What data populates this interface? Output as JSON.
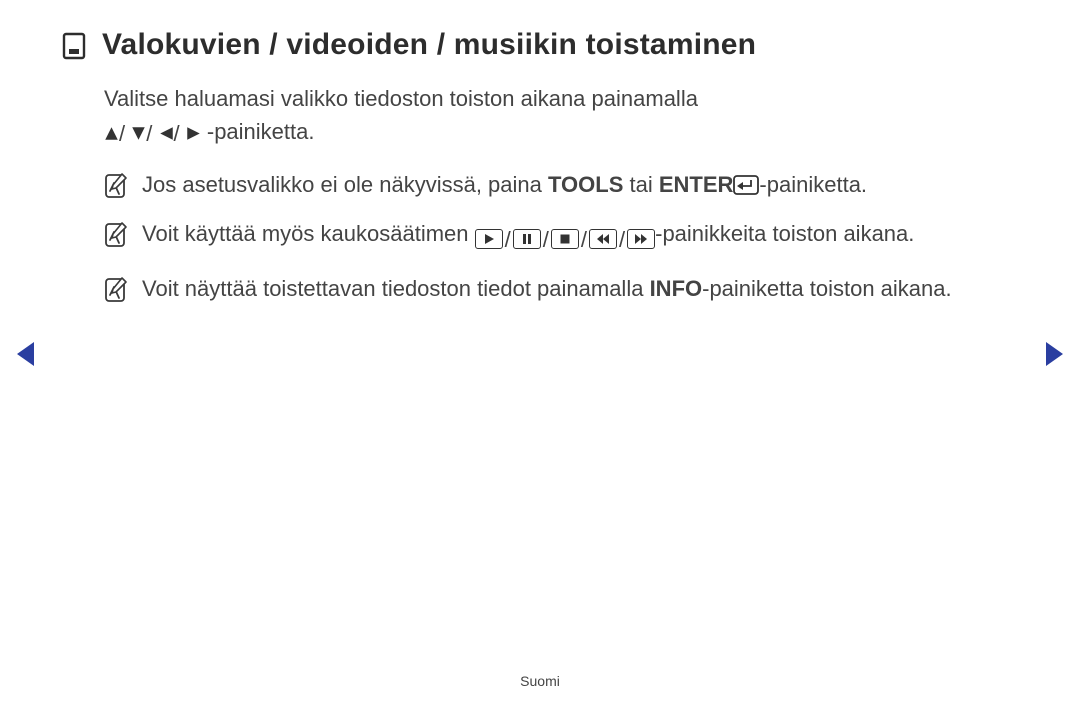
{
  "heading": "Valokuvien / videoiden / musiikin toistaminen",
  "intro_before": "Valitse haluamasi valikko tiedoston toiston aikana painamalla",
  "intro_after": "-painiketta.",
  "notes": {
    "n1_before": "Jos asetusvalikko ei ole näkyvissä, paina ",
    "n1_tools": "TOOLS",
    "n1_mid": " tai ",
    "n1_enter": "ENTER",
    "n1_after": "-painiketta.",
    "n2_before": "Voit käyttää myös kaukosäätimen ",
    "n2_after": "-painikkeita toiston aikana.",
    "n3_before": "Voit näyttää toistettavan tiedoston tiedot painamalla ",
    "n3_info": "INFO",
    "n3_after": "-painiketta toiston aikana."
  },
  "footer": "Suomi"
}
